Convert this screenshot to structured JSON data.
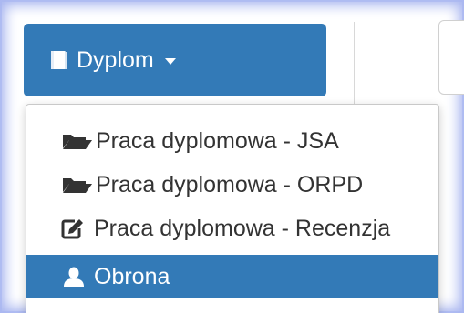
{
  "dropdown": {
    "button_label": "Dyplom",
    "button_icon": "book-icon",
    "accent_color": "#337ab7"
  },
  "menu": {
    "items": [
      {
        "label": "Praca dyplomowa - JSA",
        "icon": "folder-open-icon"
      },
      {
        "label": "Praca dyplomowa - ORPD",
        "icon": "folder-open-icon"
      },
      {
        "label": "Praca dyplomowa - Recenzja",
        "icon": "edit-icon"
      },
      {
        "label": "Obrona",
        "icon": "user-icon",
        "active": true
      }
    ]
  }
}
